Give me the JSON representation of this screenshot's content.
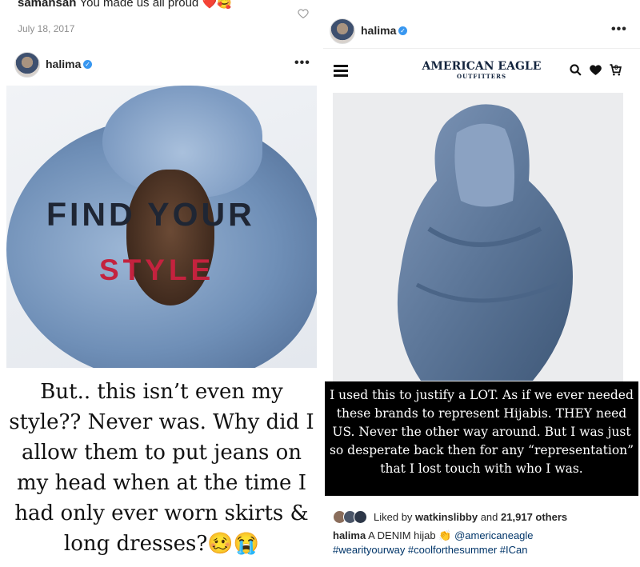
{
  "left": {
    "comment": {
      "username": "samansah",
      "text": "You made us all proud",
      "emoji": "❤️🥰"
    },
    "date": "July 18, 2017",
    "post_username": "halima",
    "more": "•••",
    "ad_text_1": "FIND YOUR",
    "ad_text_2": "STYLE",
    "caption": "But.. this isn’t even my style?? Never was. Why did I allow them to put jeans on my head when at the time I had only ever worn skirts & long dresses?🥴😭"
  },
  "right": {
    "post_username": "halima",
    "more": "•••",
    "brand_line1": "AMERICAN EAGLE",
    "brand_line2": "OUTFITTERS",
    "cart_count": "0",
    "caption": "I used this to justify a LOT.  As if we ever needed these brands to represent Hijabis. THEY need US. Never the other way around. But I was just so desperate back then for any “representation” that I lost touch with who I was.",
    "likes_prefix": "Liked by",
    "likes_user": "watkinslibby",
    "likes_and": "and",
    "likes_count": "21,917 others",
    "post_caption_user": "halima",
    "post_caption_text": "A DENIM hijab 👏",
    "post_caption_mention": "@americaneagle",
    "post_caption_tags": "#wearityourway #coolforthesummer #ICan"
  },
  "colors": {
    "verified": "#3897f0",
    "style_red": "#c4223e",
    "brand_navy": "#14253e"
  }
}
